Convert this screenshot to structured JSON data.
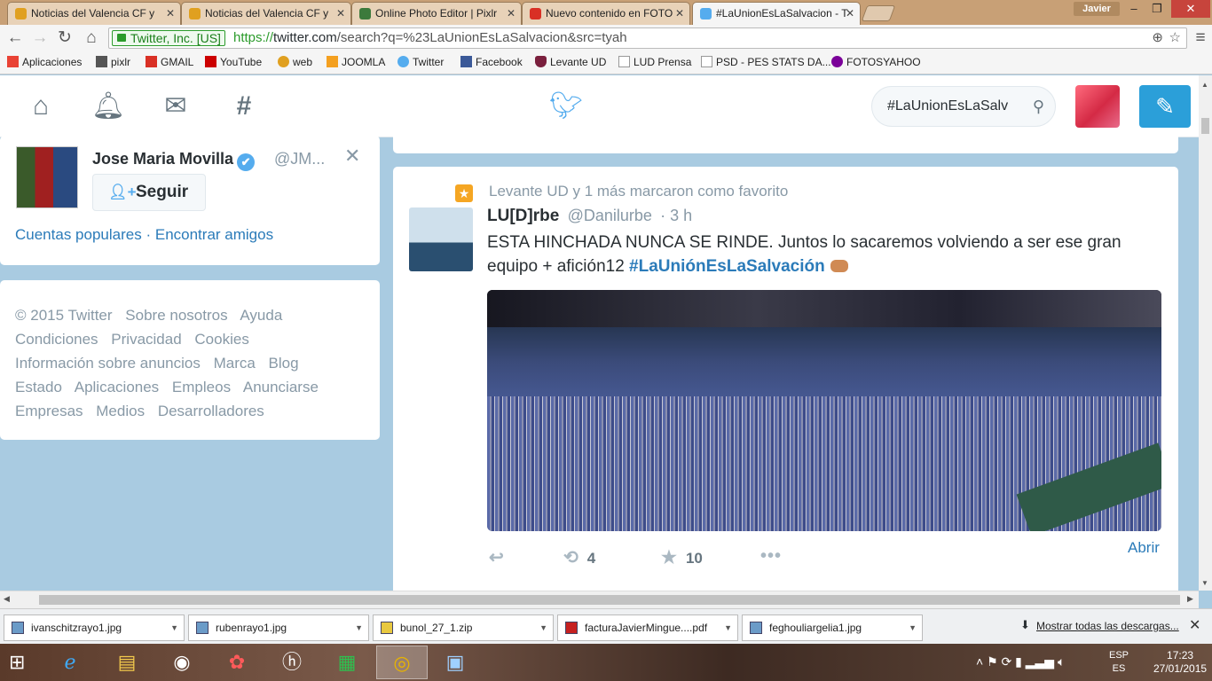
{
  "browser": {
    "tabs": [
      {
        "label": "Noticias del Valencia CF y",
        "color": "#e0a020"
      },
      {
        "label": "Noticias del Valencia CF y",
        "color": "#e0a020"
      },
      {
        "label": "Online Photo Editor | Pixlr",
        "color": "#3c7a3c"
      },
      {
        "label": "Nuevo contenido en FOTO",
        "color": "#d93025"
      },
      {
        "label": "#LaUnionEsLaSalvacion - T",
        "color": "#55acee"
      }
    ],
    "user": "Javier",
    "window_controls": {
      "minimize": "–",
      "maximize": "❐",
      "close": "✕"
    },
    "ssl_label": "Twitter, Inc. [US]",
    "url_scheme": "https://",
    "url_host": "twitter.com",
    "url_path": "/search?q=%23LaUnionEsLaSalvacion&src=tyah",
    "bookmarks": [
      {
        "label": "Aplicaciones",
        "icon": "apps-grid-icon",
        "color": "#e94235"
      },
      {
        "label": "pixlr",
        "icon": "pencil-icon",
        "color": "#555555"
      },
      {
        "label": "GMAIL",
        "icon": "gmail-icon",
        "color": "#d93025"
      },
      {
        "label": "YouTube",
        "icon": "youtube-icon",
        "color": "#cc0000"
      },
      {
        "label": "web",
        "icon": "web-icon",
        "color": "#e0a020"
      },
      {
        "label": "JOOMLA",
        "icon": "joomla-icon",
        "color": "#f4a020"
      },
      {
        "label": "Twitter",
        "icon": "twitter-bird-icon",
        "color": "#55acee"
      },
      {
        "label": "Facebook",
        "icon": "facebook-icon",
        "color": "#3b5998"
      },
      {
        "label": "Levante UD",
        "icon": "levante-crest-icon",
        "color": "#7a1f3d"
      },
      {
        "label": "LUD Prensa",
        "icon": "page-icon",
        "color": "#999999"
      },
      {
        "label": "PSD - PES STATS DA...",
        "icon": "page-icon",
        "color": "#999999"
      },
      {
        "label": "FOTOSYAHOO",
        "icon": "yahoo-icon",
        "color": "#7b0099"
      }
    ]
  },
  "twitter": {
    "search_value": "#LaUnionEsLaSalv",
    "who_to_follow": {
      "name": "Jose Maria Movilla",
      "handle": "@JM...",
      "follow_label": "Seguir",
      "popular_link": "Cuentas populares",
      "separator": "·",
      "find_friends_link": "Encontrar amigos"
    },
    "footer_links": [
      "© 2015 Twitter",
      "Sobre nosotros",
      "Ayuda",
      "Condiciones",
      "Privacidad",
      "Cookies",
      "Información sobre anuncios",
      "Marca",
      "Blog",
      "Estado",
      "Aplicaciones",
      "Empleos",
      "Anunciarse",
      "Empresas",
      "Medios",
      "Desarrolladores"
    ],
    "tweet": {
      "context": "Levante UD y 1 más marcaron como favorito",
      "author": "LU[D]rbe",
      "handle": "@Danilurbe",
      "time": "· 3 h",
      "text_before": "ESTA HINCHADA NUNCA SE RINDE. Juntos lo sacaremos volviendo a ser ese gran equipo + afición12 ",
      "hashtag": "#LaUniónEsLaSalvación",
      "retweets": "4",
      "favorites": "10",
      "open_label": "Abrir"
    }
  },
  "downloads": {
    "items": [
      "ivanschitzrayo1.jpg",
      "rubenrayo1.jpg",
      "bunol_27_1.zip",
      "facturaJavierMingue....pdf",
      "feghouliargelia1.jpg"
    ],
    "show_all": "Mostrar todas las descargas..."
  },
  "taskbar": {
    "lang_top": "ESP",
    "lang_bottom": "ES",
    "time": "17:23",
    "date": "27/01/2015"
  }
}
